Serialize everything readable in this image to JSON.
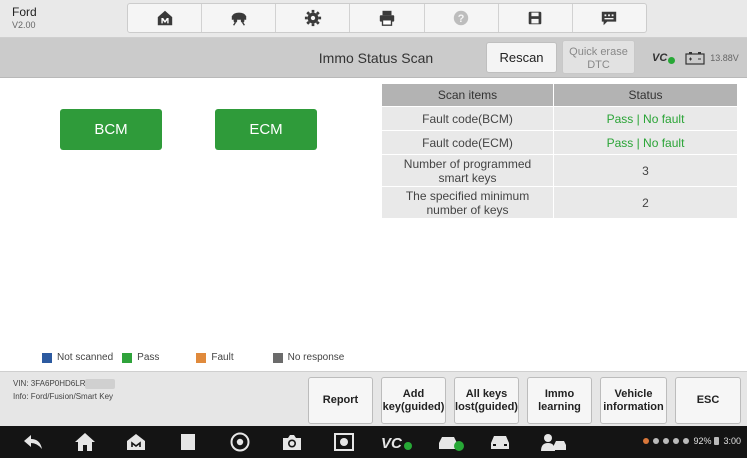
{
  "header": {
    "brand": "Ford",
    "version": "V2.00",
    "tools": [
      "home-icon",
      "vehicle-swap-icon",
      "settings-icon",
      "print-icon",
      "help-icon",
      "save-icon",
      "message-icon"
    ]
  },
  "titlebar": {
    "title": "Immo Status Scan",
    "rescan_label": "Rescan",
    "quick_erase_line1": "Quick erase",
    "quick_erase_line2": "DTC",
    "vci_label": "VC",
    "voltage": "13.88V"
  },
  "modules": {
    "bcm_label": "BCM",
    "ecm_label": "ECM",
    "color": "#2f9b3a"
  },
  "table": {
    "headers": [
      "Scan items",
      "Status"
    ],
    "rows": [
      {
        "item": "Fault code(BCM)",
        "status": "Pass | No fault"
      },
      {
        "item": "Fault code(ECM)",
        "status": "Pass | No fault"
      },
      {
        "item_line1": "Number of programmed",
        "item_line2": "smart keys",
        "status": "3"
      },
      {
        "item_line1": "The specified minimum",
        "item_line2": "number of keys",
        "status": "2"
      }
    ]
  },
  "legend": [
    {
      "label": "Not scanned",
      "color": "#2c5aa0"
    },
    {
      "label": "Pass",
      "color": "#2fa33b"
    },
    {
      "label": "Fault",
      "color": "#e08a3c"
    },
    {
      "label": "No response",
      "color": "#6b6b6b"
    }
  ],
  "footer": {
    "vin_label": "VIN: 3FA6P0HD6LR",
    "info_label": "Info: Ford/Fusion/Smart Key",
    "buttons": [
      {
        "line1": "Report",
        "line2": ""
      },
      {
        "line1": "Add",
        "line2": "key(guided)"
      },
      {
        "line1": "All keys",
        "line2": "lost(guided)"
      },
      {
        "line1": "Immo",
        "line2": "learning"
      },
      {
        "line1": "Vehicle",
        "line2": "information"
      },
      {
        "line1": "ESC",
        "line2": ""
      }
    ]
  },
  "system": {
    "battery": "92%",
    "time": "3:00"
  }
}
